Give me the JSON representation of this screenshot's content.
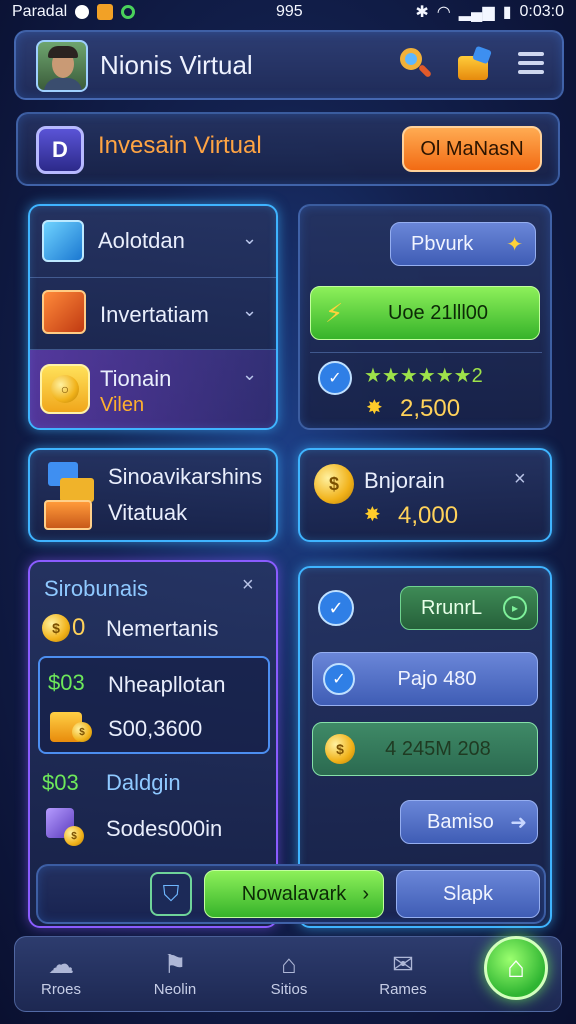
{
  "statusbar": {
    "carrier": "Paradal",
    "center": "995",
    "time": "0:03:0"
  },
  "header": {
    "title": "Nionis Virtual"
  },
  "banner": {
    "title": "Invesain Virtual",
    "button": "Ol MaNasN"
  },
  "menu": {
    "items": [
      {
        "label": "Aolotdan"
      },
      {
        "label": "Invertatiam"
      },
      {
        "label": "Tionain",
        "sub": "Vilen"
      }
    ]
  },
  "reward": {
    "pill": "Pbvurk",
    "green_button": "Uoe 21lll00",
    "stars": "★★★★★★2",
    "amount": "2,500"
  },
  "shop": {
    "line1": "Sinoavikarshins",
    "line2": "Vitatuak"
  },
  "bonus": {
    "title": "Bnjorain",
    "amount": "4,000"
  },
  "list": {
    "title": "Sirobunais",
    "row1_prefix": "0",
    "row1_label": "Nemertanis",
    "box_price": "$03",
    "box_label": "Nheapllotan",
    "box_value": "S00,3600",
    "row3_price": "$03",
    "row3_label": "Daldgin",
    "row4_label": "Sodes000in"
  },
  "actions": {
    "btn1": "RrunrL",
    "btn2": "Pajo 480",
    "btn3": "4 245M 208",
    "btn4": "Bamiso"
  },
  "bottom_actions": {
    "green": "Nowalavark",
    "blue": "Slapk"
  },
  "nav": {
    "items": [
      {
        "label": "Rroes"
      },
      {
        "label": "Neolin"
      },
      {
        "label": "Sitios"
      },
      {
        "label": "Rames"
      }
    ]
  }
}
